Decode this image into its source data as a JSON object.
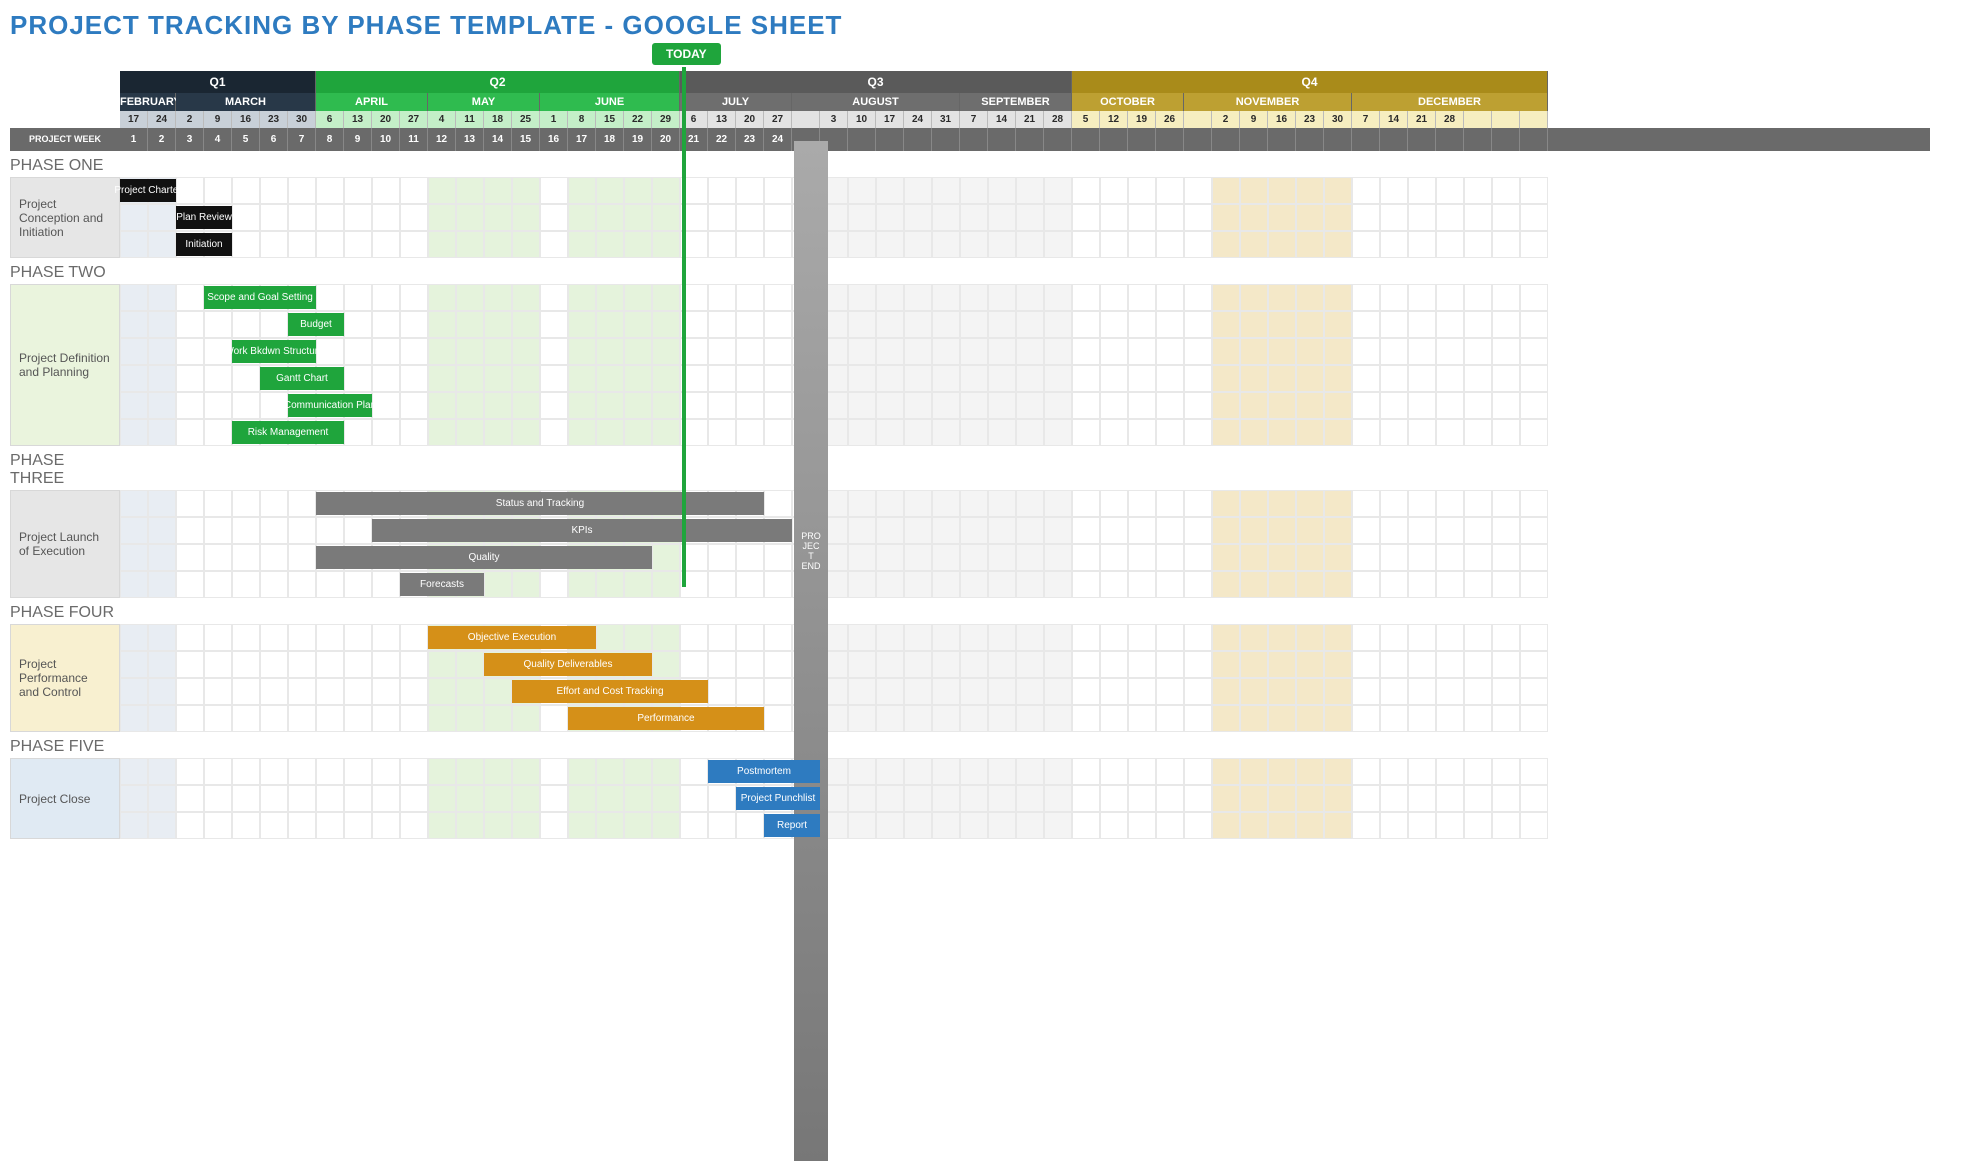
{
  "title": "PROJECT TRACKING BY PHASE TEMPLATE - GOOGLE SHEET",
  "today_label": "TODAY",
  "project_end_label": "PRO\nJEC\nT\nEND",
  "project_week_label": "PROJECT WEEK",
  "quarters": [
    "Q1",
    "Q2",
    "Q3",
    "Q4"
  ],
  "months": [
    "FEBRUARY",
    "MARCH",
    "APRIL",
    "MAY",
    "JUNE",
    "JULY",
    "AUGUST",
    "SEPTEMBER",
    "OCTOBER",
    "NOVEMBER",
    "DECEMBER"
  ],
  "dates": [
    17,
    24,
    2,
    9,
    16,
    23,
    30,
    6,
    13,
    20,
    27,
    4,
    11,
    18,
    25,
    1,
    8,
    15,
    22,
    29,
    6,
    13,
    20,
    27,
    "",
    3,
    10,
    17,
    24,
    31,
    7,
    14,
    21,
    28,
    5,
    12,
    19,
    26,
    "",
    2,
    9,
    16,
    23,
    30,
    7,
    14,
    21,
    28
  ],
  "weeks": [
    1,
    2,
    3,
    4,
    5,
    6,
    7,
    8,
    9,
    10,
    11,
    12,
    13,
    14,
    15,
    16,
    17,
    18,
    19,
    20,
    21,
    22,
    23,
    24
  ],
  "phase_titles": [
    "PHASE ONE",
    "PHASE TWO",
    "PHASE THREE",
    "PHASE FOUR",
    "PHASE FIVE"
  ],
  "phase_labels": {
    "p1": "Project Conception and Initiation",
    "p2": "Project Definition and Planning",
    "p3": "Project Launch of Execution",
    "p4": "Project Performance and Control",
    "p5": "Project Close"
  },
  "tasks": {
    "charter": "Project Charter",
    "plan_review": "Plan Review",
    "initiation": "Initiation",
    "scope": "Scope and Goal Setting",
    "budget": "Budget",
    "wbs": "Work Bkdwn Structure",
    "gantt": "Gantt Chart",
    "comm": "Communication Plan",
    "risk": "Risk Management",
    "status": "Status  and Tracking",
    "kpis": "KPIs",
    "quality": "Quality",
    "forecasts": "Forecasts",
    "obj_exec": "Objective Execution",
    "qual_del": "Quality Deliverables",
    "effort": "Effort and Cost Tracking",
    "perf": "Performance",
    "postmortem": "Postmortem",
    "punchlist": "Project Punchlist",
    "report": "Report"
  },
  "chart_data": {
    "type": "gantt",
    "title": "Project Tracking by Phase",
    "x_unit": "project_week",
    "x_range": [
      1,
      51
    ],
    "today_week": 21,
    "project_end_week": 25,
    "quarters": [
      {
        "name": "Q1",
        "weeks": [
          1,
          7
        ]
      },
      {
        "name": "Q2",
        "weeks": [
          8,
          20
        ]
      },
      {
        "name": "Q3",
        "weeks": [
          21,
          34
        ]
      },
      {
        "name": "Q4",
        "weeks": [
          35,
          51
        ]
      }
    ],
    "months": [
      {
        "name": "FEBRUARY",
        "weeks": [
          1,
          2
        ]
      },
      {
        "name": "MARCH",
        "weeks": [
          3,
          7
        ]
      },
      {
        "name": "APRIL",
        "weeks": [
          8,
          11
        ]
      },
      {
        "name": "MAY",
        "weeks": [
          12,
          15
        ]
      },
      {
        "name": "JUNE",
        "weeks": [
          16,
          20
        ]
      },
      {
        "name": "JULY",
        "weeks": [
          21,
          24
        ]
      },
      {
        "name": "AUGUST",
        "weeks": [
          26,
          30
        ]
      },
      {
        "name": "SEPTEMBER",
        "weeks": [
          31,
          34
        ]
      },
      {
        "name": "OCTOBER",
        "weeks": [
          35,
          38
        ]
      },
      {
        "name": "NOVEMBER",
        "weeks": [
          40,
          44
        ]
      },
      {
        "name": "DECEMBER",
        "weeks": [
          45,
          48
        ]
      }
    ],
    "phases": [
      {
        "name": "PHASE ONE",
        "label": "Project Conception and Initiation",
        "color": "#e0e0e0",
        "tasks": [
          {
            "name": "Project Charter",
            "start": 1,
            "end": 2,
            "color": "#111"
          },
          {
            "name": "Plan Review",
            "start": 3,
            "end": 4,
            "color": "#111"
          },
          {
            "name": "Initiation",
            "start": 3,
            "end": 4,
            "color": "#111"
          }
        ]
      },
      {
        "name": "PHASE TWO",
        "label": "Project Definition and Planning",
        "color": "#e5f3dc",
        "tasks": [
          {
            "name": "Scope and Goal Setting",
            "start": 4,
            "end": 7,
            "color": "#1fa53c"
          },
          {
            "name": "Budget",
            "start": 7,
            "end": 8,
            "color": "#1fa53c"
          },
          {
            "name": "Work Bkdwn Structure",
            "start": 5,
            "end": 7,
            "color": "#1fa53c"
          },
          {
            "name": "Gantt Chart",
            "start": 6,
            "end": 8,
            "color": "#1fa53c"
          },
          {
            "name": "Communication Plan",
            "start": 7,
            "end": 9,
            "color": "#1fa53c"
          },
          {
            "name": "Risk Management",
            "start": 5,
            "end": 8,
            "color": "#1fa53c"
          }
        ]
      },
      {
        "name": "PHASE THREE",
        "label": "Project Launch of Execution",
        "color": "#e6e6e6",
        "tasks": [
          {
            "name": "Status and Tracking",
            "start": 8,
            "end": 23,
            "color": "#7a7a7a"
          },
          {
            "name": "KPIs",
            "start": 10,
            "end": 24,
            "color": "#7a7a7a"
          },
          {
            "name": "Quality",
            "start": 8,
            "end": 19,
            "color": "#7a7a7a"
          },
          {
            "name": "Forecasts",
            "start": 11,
            "end": 13,
            "color": "#7a7a7a"
          }
        ]
      },
      {
        "name": "PHASE FOUR",
        "label": "Project Performance and Control",
        "color": "#f8f0d0",
        "tasks": [
          {
            "name": "Objective Execution",
            "start": 12,
            "end": 17,
            "color": "#d59018"
          },
          {
            "name": "Quality Deliverables",
            "start": 14,
            "end": 19,
            "color": "#d59018"
          },
          {
            "name": "Effort and Cost Tracking",
            "start": 15,
            "end": 21,
            "color": "#d59018"
          },
          {
            "name": "Performance",
            "start": 17,
            "end": 23,
            "color": "#d59018"
          }
        ]
      },
      {
        "name": "PHASE FIVE",
        "label": "Project Close",
        "color": "#e0eaf3",
        "tasks": [
          {
            "name": "Postmortem",
            "start": 22,
            "end": 25,
            "color": "#2e7bc0"
          },
          {
            "name": "Project Punchlist",
            "start": 23,
            "end": 25,
            "color": "#2e7bc0"
          },
          {
            "name": "Report",
            "start": 24,
            "end": 25,
            "color": "#2e7bc0"
          }
        ]
      }
    ]
  }
}
